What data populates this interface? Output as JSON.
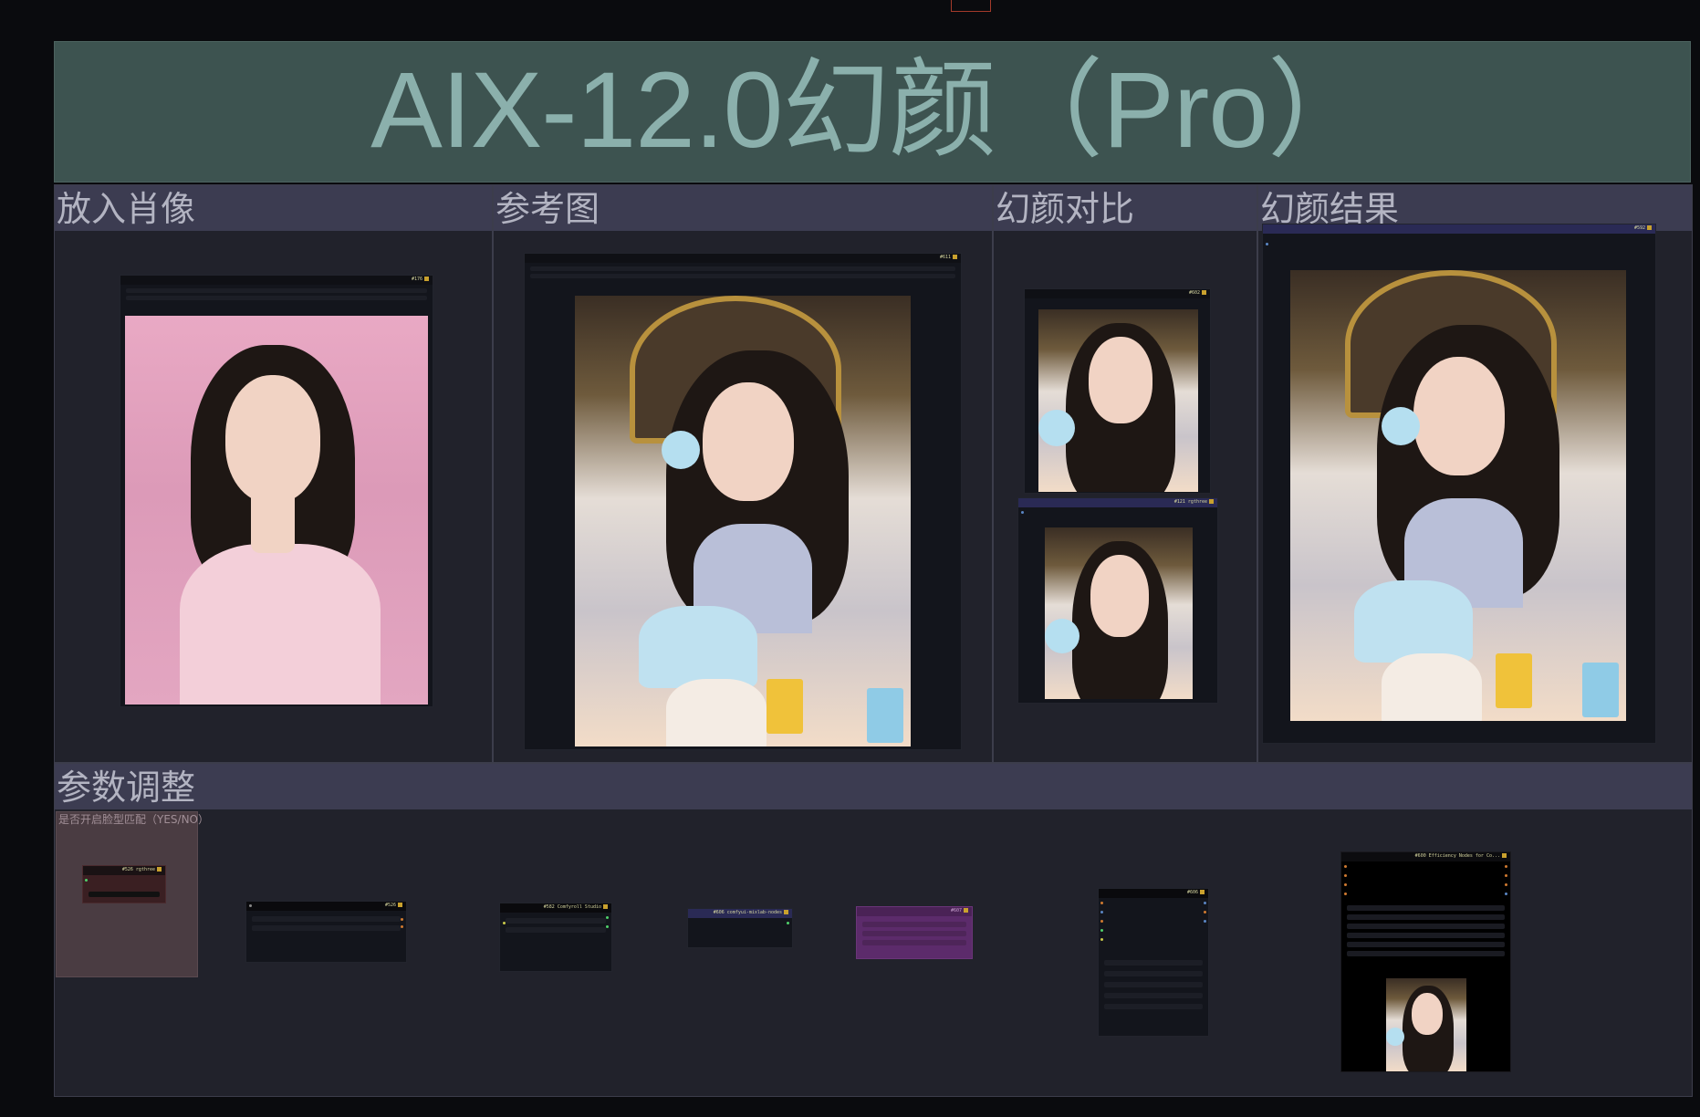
{
  "title": "AIX-12.0幻颜（Pro）",
  "groups": {
    "portrait": {
      "label": "放入肖像",
      "node_id": "#176"
    },
    "reference": {
      "label": "参考图",
      "node_id": "#611"
    },
    "compare": {
      "label": "幻颜对比",
      "node_id_top": "#602",
      "node_id_bottom": "#121 rgthree"
    },
    "result": {
      "label": "幻颜结果",
      "node_id": "#592"
    },
    "params": {
      "label": "参数调整"
    }
  },
  "param_nodes": {
    "switch_label": "是否开启脸型匹配（YES/NO）",
    "switch_node_id": "#526 rgthree",
    "node_a_id": "#526",
    "node_b_id": "#582 Comfyroll Studio",
    "node_c_id": "#606 comfyui-mixlab-nodes",
    "node_d_id": "#607",
    "node_e_id": "#606",
    "node_f_id": "#600 Efficiency Nodes for Co..."
  },
  "colors": {
    "title_bg": "#3d5350",
    "title_text": "#8bb0ac",
    "group_header": "#3c3c51",
    "group_body": "#21222b",
    "node_body": "#13151c",
    "purple_node": "#5c2b6b"
  }
}
